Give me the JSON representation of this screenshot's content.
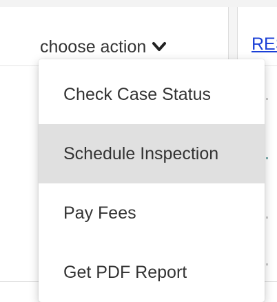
{
  "header": {
    "action_label": "choose action",
    "reset_label": "RES"
  },
  "menu": {
    "items": [
      {
        "label": "Check Case Status",
        "highlighted": false
      },
      {
        "label": "Schedule Inspection",
        "highlighted": true
      },
      {
        "label": "Pay Fees",
        "highlighted": false
      },
      {
        "label": "Get PDF Report",
        "highlighted": false
      }
    ]
  },
  "colors": {
    "text": "#333333",
    "link": "#1a3fd6",
    "highlight": "#e0e0e0"
  },
  "icons": {
    "toggle": "chevron-down-icon"
  }
}
